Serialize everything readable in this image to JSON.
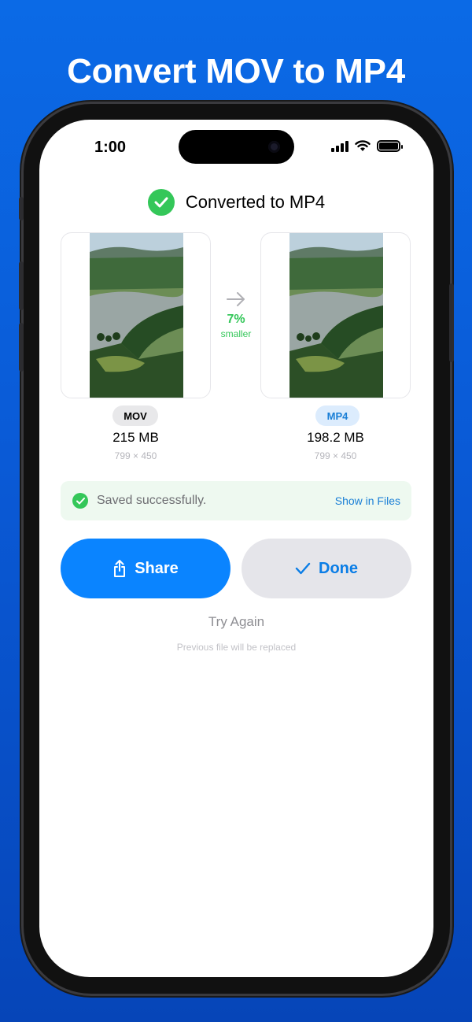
{
  "headline": "Convert MOV to MP4",
  "status_bar": {
    "time": "1:00",
    "icons": [
      "cellular-signal-icon",
      "wifi-icon",
      "battery-icon"
    ]
  },
  "result": {
    "title": "Converted to MP4",
    "source": {
      "format": "MOV",
      "size": "215 MB",
      "dimensions": "799 × 450"
    },
    "output": {
      "format": "MP4",
      "size": "198.2 MB",
      "dimensions": "799 × 450"
    },
    "reduction": {
      "percent": "7%",
      "label": "smaller"
    }
  },
  "saved_banner": {
    "text": "Saved successfully.",
    "link": "Show in Files"
  },
  "buttons": {
    "share": "Share",
    "done": "Done"
  },
  "try_again": "Try Again",
  "replace_note": "Previous file will be replaced",
  "colors": {
    "background": "#0b6ae6",
    "accent_blue": "#0a84ff",
    "success_green": "#34c759",
    "done_button_bg": "#e5e5ea"
  }
}
